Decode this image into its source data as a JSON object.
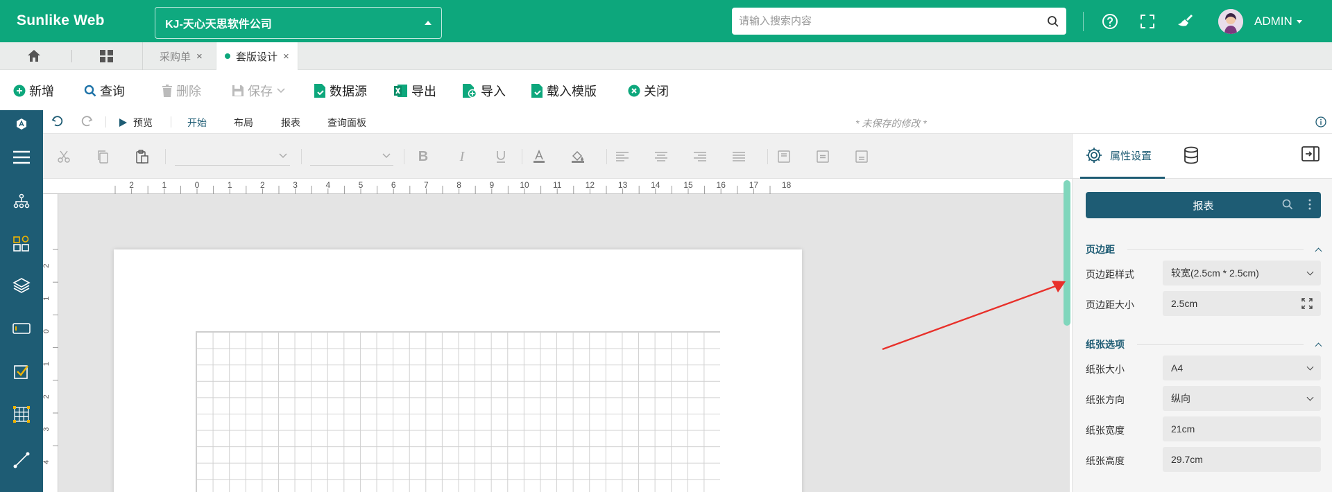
{
  "header": {
    "brand": "Sunlike Web",
    "company": "KJ-天心天思软件公司",
    "search_placeholder": "请输入搜索内容",
    "user": "ADMIN"
  },
  "tabs": {
    "items": [
      {
        "label": "采购单",
        "close": "×"
      },
      {
        "label": "套版设计",
        "close": "×"
      }
    ]
  },
  "actions": {
    "new": "新增",
    "query": "查询",
    "delete": "删除",
    "save": "保存",
    "datasource": "数据源",
    "export": "导出",
    "import": "导入",
    "load_template": "载入模版",
    "close": "关闭"
  },
  "designer_tabs": {
    "preview": "预览",
    "start": "开始",
    "layout": "布局",
    "report": "报表",
    "query_panel": "查询面板",
    "unsaved": "* 未保存的修改 *"
  },
  "ruler": {
    "h": [
      "2",
      "1",
      "0",
      "1",
      "2",
      "3",
      "4",
      "5",
      "6",
      "7",
      "8",
      "9",
      "10",
      "11",
      "12",
      "13",
      "14",
      "15",
      "16",
      "17",
      "18"
    ],
    "v": [
      "2",
      "1",
      "0",
      "1",
      "2",
      "3",
      "4"
    ]
  },
  "panel": {
    "tab_properties": "属性设置",
    "object_button": "报表",
    "section_margins": "页边距",
    "section_paper": "纸张选项",
    "props": [
      {
        "label": "页边距样式",
        "value": "较宽(2.5cm * 2.5cm)",
        "kind": "dropdown"
      },
      {
        "label": "页边距大小",
        "value": "2.5cm",
        "kind": "expand"
      },
      {
        "label": "纸张大小",
        "value": "A4",
        "kind": "dropdown"
      },
      {
        "label": "纸张方向",
        "value": "纵向",
        "kind": "dropdown"
      },
      {
        "label": "纸张宽度",
        "value": "21cm",
        "kind": "text"
      },
      {
        "label": "纸张高度",
        "value": "29.7cm",
        "kind": "text"
      }
    ]
  },
  "colors": {
    "brand_green": "#0da77c",
    "sidebar_blue": "#1e5c74",
    "annotation_red": "#e8302a"
  }
}
